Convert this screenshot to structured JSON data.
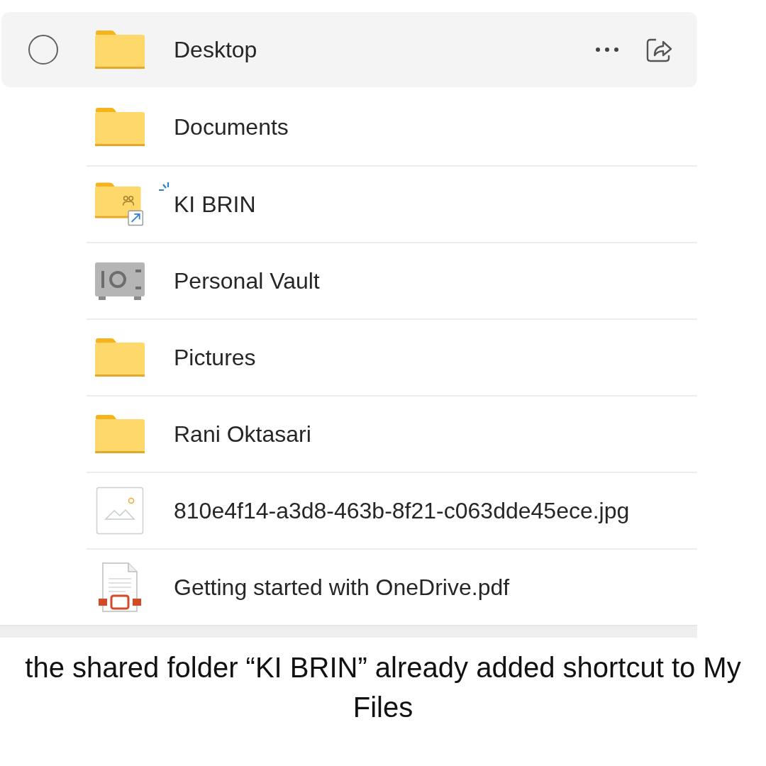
{
  "file_list": {
    "items": [
      {
        "kind": "folder",
        "name": "Desktop",
        "highlighted": true,
        "is_new": false
      },
      {
        "kind": "folder",
        "name": "Documents",
        "highlighted": false,
        "is_new": false
      },
      {
        "kind": "shared-folder",
        "name": "KI BRIN",
        "highlighted": false,
        "is_new": true
      },
      {
        "kind": "vault",
        "name": "Personal Vault",
        "highlighted": false,
        "is_new": false
      },
      {
        "kind": "folder",
        "name": "Pictures",
        "highlighted": false,
        "is_new": false
      },
      {
        "kind": "folder",
        "name": "Rani Oktasari",
        "highlighted": false,
        "is_new": false
      },
      {
        "kind": "image",
        "name": "810e4f14-a3d8-463b-8f21-c063dde45ece.jpg",
        "highlighted": false,
        "is_new": false
      },
      {
        "kind": "pdf",
        "name": "Getting started with OneDrive.pdf",
        "highlighted": false,
        "is_new": false
      }
    ]
  },
  "caption": "the shared folder “KI BRIN” already added shortcut to My Files"
}
